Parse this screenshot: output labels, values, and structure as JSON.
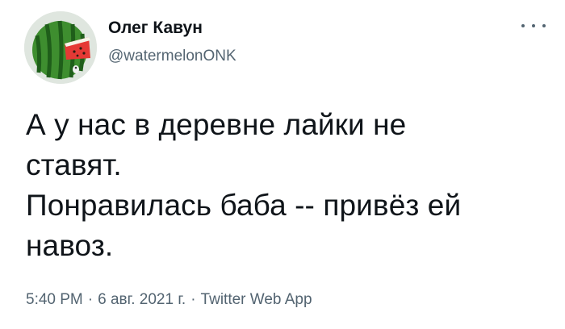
{
  "author": {
    "display_name": "Олег Кавун",
    "handle": "@watermelonONK",
    "avatar_icon": "watermelon-avatar"
  },
  "more_icon": "more-dots-icon",
  "tweet": {
    "lines": [
      "А у нас в деревне лайки не",
      "ставят.",
      "Понравилась баба -- привёз ей",
      "навоз."
    ]
  },
  "meta": {
    "time": "5:40 PM",
    "date": "6 авг. 2021 г.",
    "source": "Twitter Web App",
    "separator": "·"
  },
  "colors": {
    "text": "#0f1419",
    "secondary": "#536471",
    "watermelon_rind": "#2e7d32",
    "watermelon_flesh": "#e53935"
  }
}
